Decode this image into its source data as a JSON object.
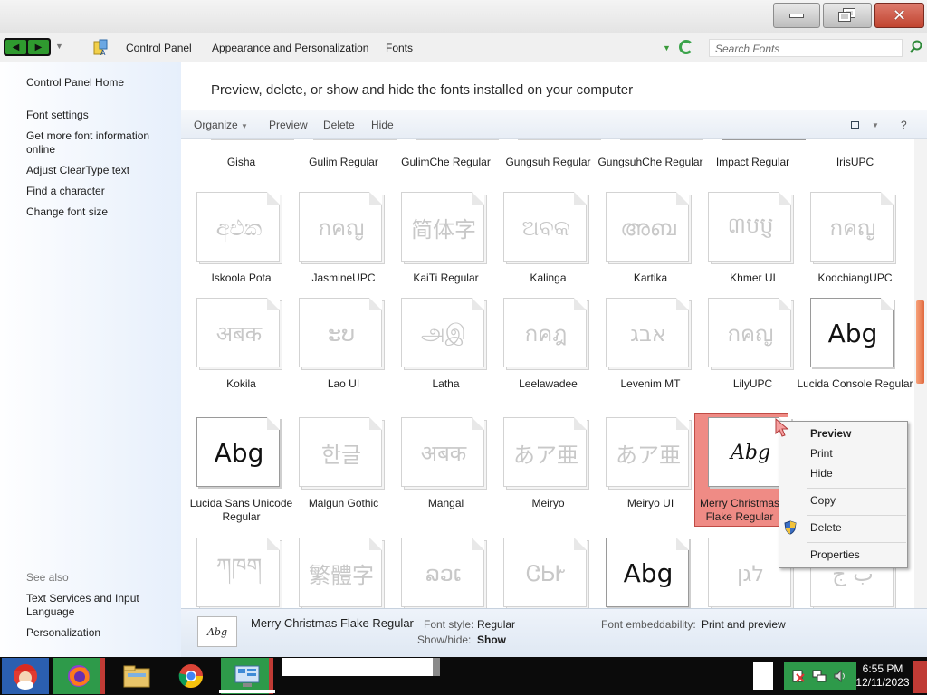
{
  "window": {
    "minimize_label": "",
    "maximize_label": "",
    "close_label": "✕"
  },
  "address": {
    "crumbs": [
      "Control Panel",
      "Appearance and Personalization",
      "Fonts"
    ],
    "search_placeholder": "Search Fonts"
  },
  "sidebar": {
    "home": "Control Panel Home",
    "links": [
      "Font settings",
      "Get more font information online",
      "Adjust ClearType text",
      "Find a character",
      "Change font size"
    ],
    "see_also_heading": "See also",
    "see_also": [
      "Text Services and Input Language",
      "Personalization"
    ]
  },
  "main": {
    "heading": "Preview, delete, or show and hide the fonts installed on your computer"
  },
  "toolbar": {
    "organize": "Organize",
    "preview": "Preview",
    "delete": "Delete",
    "hide": "Hide",
    "help": "?"
  },
  "fonts": {
    "row0": [
      "Gisha",
      "Gulim Regular",
      "GulimChe Regular",
      "Gungsuh Regular",
      "GungsuhChe Regular",
      "Impact Regular",
      "IrisUPC"
    ],
    "row1": [
      {
        "name": "Iskoola Pota",
        "sample": "අඑක"
      },
      {
        "name": "JasmineUPC",
        "sample": "กคญ"
      },
      {
        "name": "KaiTi Regular",
        "sample": "简体字"
      },
      {
        "name": "Kalinga",
        "sample": "ଅବକ"
      },
      {
        "name": "Kartika",
        "sample": "അബ"
      },
      {
        "name": "Khmer UI",
        "sample": "៣បប្ញ"
      },
      {
        "name": "KodchiangUPC",
        "sample": "กคญ"
      }
    ],
    "row2": [
      {
        "name": "Kokila",
        "sample": "अबक"
      },
      {
        "name": "Lao UI",
        "sample": "ະບ"
      },
      {
        "name": "Latha",
        "sample": "அஇ"
      },
      {
        "name": "Leelawadee",
        "sample": "กคฎ"
      },
      {
        "name": "Levenim MT",
        "sample": "אבג"
      },
      {
        "name": "LilyUPC",
        "sample": "กคญ"
      },
      {
        "name": "Lucida Console Regular",
        "sample": "Abg"
      }
    ],
    "row3": [
      {
        "name": "Lucida Sans Unicode Regular",
        "sample": "Abg"
      },
      {
        "name": "Malgun Gothic",
        "sample": "한글"
      },
      {
        "name": "Mangal",
        "sample": "अबक"
      },
      {
        "name": "Meiryo",
        "sample": "あア亜"
      },
      {
        "name": "Meiryo UI",
        "sample": "あア亜"
      },
      {
        "name": "Merry Christmas Flake Regular",
        "sample": "Abg"
      }
    ],
    "row4": [
      {
        "sample": "ཀཁག"
      },
      {
        "sample": "繁體字"
      },
      {
        "sample": "ລວເ"
      },
      {
        "sample": "ᏣᏏᎨ"
      },
      {
        "sample": "Abg"
      },
      {
        "sample": "לגן"
      },
      {
        "sample": "ب ج"
      }
    ]
  },
  "details": {
    "name": "Merry Christmas Flake Regular",
    "thumb_sample": "Abg",
    "style_label": "Font style:",
    "style_value": "Regular",
    "showhide_label": "Show/hide:",
    "showhide_value": "Show",
    "embed_label": "Font embeddability:",
    "embed_value": "Print and preview"
  },
  "context_menu": {
    "items": [
      "Preview",
      "Print",
      "Hide",
      "Copy",
      "Delete",
      "Properties"
    ]
  },
  "taskbar": {
    "time": "6:55 PM",
    "date": "12/11/2023"
  }
}
